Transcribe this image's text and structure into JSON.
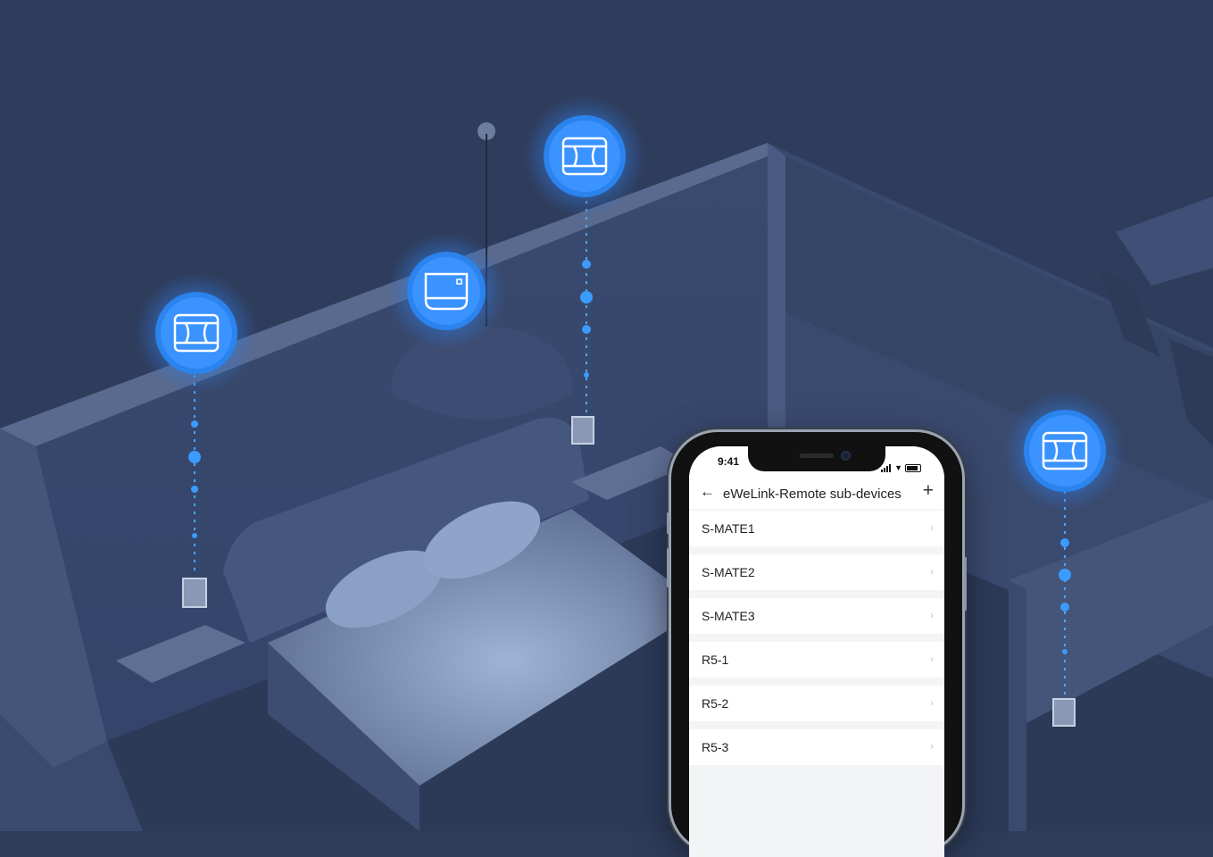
{
  "phone": {
    "status_bar": {
      "time": "9:41"
    },
    "header": {
      "back_icon": "left-arrow-icon",
      "title": "eWeLink-Remote sub-devices",
      "add_icon": "plus-icon"
    },
    "devices": [
      {
        "label": "S-MATE1"
      },
      {
        "label": "S-MATE2"
      },
      {
        "label": "S-MATE3"
      },
      {
        "label": "R5-1"
      },
      {
        "label": "R5-2"
      },
      {
        "label": "R5-3"
      }
    ]
  },
  "colors": {
    "scene_background": "#2e3c5a",
    "glow_accent": "#2f8df5",
    "phone_screen": "#f3f4f6"
  }
}
